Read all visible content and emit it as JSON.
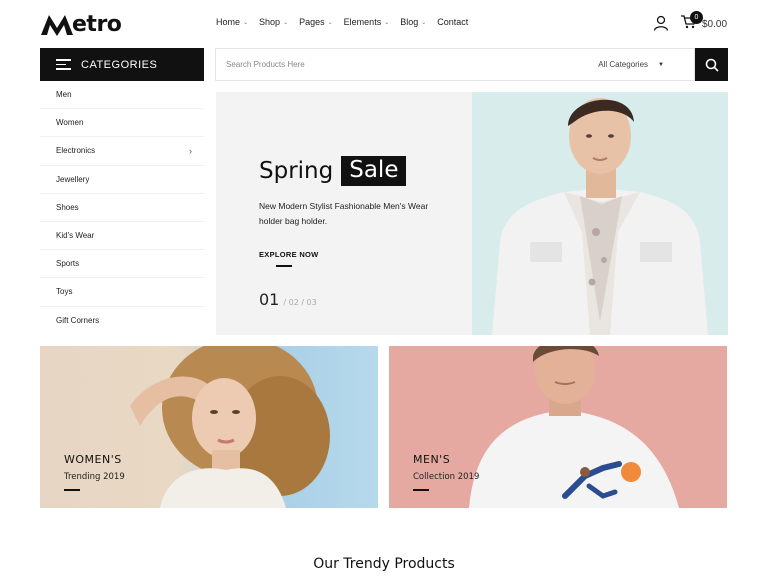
{
  "header": {
    "logo_text": "etro",
    "logo_letter": "M",
    "nav": [
      {
        "label": "Home",
        "has_dropdown": true
      },
      {
        "label": "Shop",
        "has_dropdown": true
      },
      {
        "label": "Pages",
        "has_dropdown": true
      },
      {
        "label": "Elements",
        "has_dropdown": true
      },
      {
        "label": "Blog",
        "has_dropdown": true
      },
      {
        "label": "Contact",
        "has_dropdown": false
      }
    ],
    "cart_count": "0",
    "cart_total": "$0.00",
    "icons": [
      "user-icon",
      "cart-icon"
    ]
  },
  "categories": {
    "title": "CATEGORIES",
    "items": [
      {
        "label": "Men"
      },
      {
        "label": "Women"
      },
      {
        "label": "Electronics",
        "has_submenu": true
      },
      {
        "label": "Jewellery"
      },
      {
        "label": "Shoes"
      },
      {
        "label": "Kid's Wear"
      },
      {
        "label": "Sports"
      },
      {
        "label": "Toys"
      },
      {
        "label": "Gift Corners"
      }
    ],
    "submenu_arrow": "›"
  },
  "search": {
    "placeholder": "Search Products Here",
    "category_select": "All Categories",
    "button_icon": "search-icon"
  },
  "hero": {
    "title_word": "Spring",
    "title_highlight": "Sale",
    "description": "New Modern Stylist Fashionable Men's Wear holder bag holder.",
    "button": "EXPLORE NOW",
    "slide_current": "01",
    "slide_others": "/ 02 / 03",
    "colors": {
      "left_bg": "#f3f3f3",
      "right_bg": "#d7eceb"
    }
  },
  "banners": [
    {
      "title": "WOMEN'S",
      "subtitle": "Trending 2019"
    },
    {
      "title": "MEN'S",
      "subtitle": "Collection 2019"
    }
  ],
  "section_title": "Our Trendy Products",
  "colors": {
    "accent": "#111111",
    "men_banner_bg": "#e6a9a2"
  }
}
